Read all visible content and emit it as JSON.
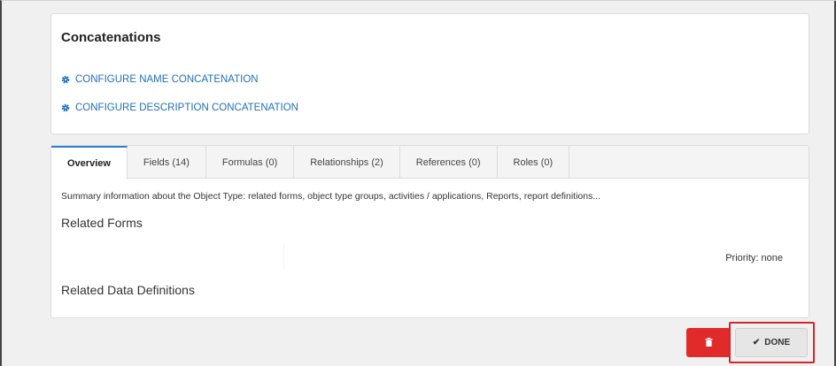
{
  "concatenations": {
    "title": "Concatenations",
    "links": [
      {
        "label": "CONFIGURE NAME CONCATENATION",
        "icon": "gear-icon"
      },
      {
        "label": "CONFIGURE DESCRIPTION CONCATENATION",
        "icon": "gear-icon"
      }
    ]
  },
  "tabs": [
    {
      "label": "Overview",
      "active": true
    },
    {
      "label": "Fields (14)"
    },
    {
      "label": "Formulas (0)"
    },
    {
      "label": "Relationships (2)"
    },
    {
      "label": "References (0)"
    },
    {
      "label": "Roles (0)"
    }
  ],
  "overview": {
    "summary": "Summary information about the Object Type: related forms, object type groups, activities / applications, Reports, report definitions...",
    "related_forms": "Related Forms",
    "priority": "Priority: none",
    "related_data_definitions": "Related Data Definitions"
  },
  "actions": {
    "delete_icon": "trash-icon",
    "done_label": "DONE",
    "done_icon": "check-icon"
  },
  "colors": {
    "link": "#1f6fb8",
    "active_tab": "#2d7fd1",
    "delete": "#e12a2a",
    "highlight": "#d1272b"
  }
}
